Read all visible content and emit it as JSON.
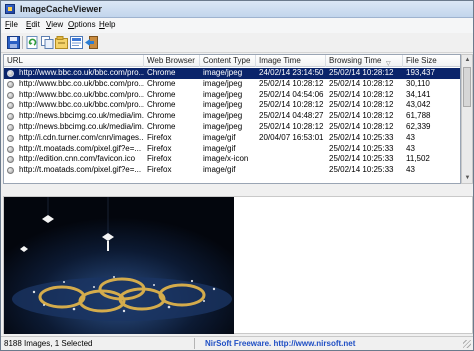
{
  "window": {
    "title": "ImageCacheViewer"
  },
  "menu": [
    {
      "label": "File",
      "hotkey": "F",
      "rest": "ile"
    },
    {
      "label": "Edit",
      "hotkey": "E",
      "rest": "dit"
    },
    {
      "label": "View",
      "hotkey": "V",
      "rest": "iew"
    },
    {
      "label": "Options",
      "hotkey": "O",
      "rest": "ptions"
    },
    {
      "label": "Help",
      "hotkey": "H",
      "rest": "elp"
    }
  ],
  "toolbar": {
    "icons": [
      "save-icon",
      "refresh-icon",
      "copy-icon",
      "properties-icon",
      "html-report-icon",
      "exit-icon"
    ]
  },
  "table": {
    "columns": [
      "URL",
      "Web Browser",
      "Content Type",
      "Image Time",
      "Browsing Time",
      "File Size"
    ],
    "sorted_column": "Browsing Time",
    "rows": [
      {
        "url": "http://www.bbc.co.uk/bbc.com/pro...",
        "browser": "Chrome",
        "type": "image/jpeg",
        "image_time": "24/02/14 23:14:50",
        "browsing_time": "25/02/14 10:28:12",
        "size": "193,437",
        "selected": true
      },
      {
        "url": "http://www.bbc.co.uk/bbc.com/pro...",
        "browser": "Chrome",
        "type": "image/jpeg",
        "image_time": "25/02/14 10:28:12",
        "browsing_time": "25/02/14 10:28:12",
        "size": "30,110",
        "selected": false
      },
      {
        "url": "http://www.bbc.co.uk/bbc.com/pro...",
        "browser": "Chrome",
        "type": "image/jpeg",
        "image_time": "25/02/14 04:54:06",
        "browsing_time": "25/02/14 10:28:12",
        "size": "34,141",
        "selected": false
      },
      {
        "url": "http://www.bbc.co.uk/bbc.com/pro...",
        "browser": "Chrome",
        "type": "image/jpeg",
        "image_time": "25/02/14 10:28:12",
        "browsing_time": "25/02/14 10:28:12",
        "size": "43,042",
        "selected": false
      },
      {
        "url": "http://news.bbcimg.co.uk/media/im...",
        "browser": "Chrome",
        "type": "image/jpeg",
        "image_time": "25/02/14 04:48:27",
        "browsing_time": "25/02/14 10:28:12",
        "size": "61,788",
        "selected": false
      },
      {
        "url": "http://news.bbcimg.co.uk/media/im...",
        "browser": "Chrome",
        "type": "image/jpeg",
        "image_time": "25/02/14 10:28:12",
        "browsing_time": "25/02/14 10:28:12",
        "size": "62,339",
        "selected": false
      },
      {
        "url": "http://i.cdn.turner.com/cnn/images...",
        "browser": "Firefox",
        "type": "image/gif",
        "image_time": "20/04/07 16:53:01",
        "browsing_time": "25/02/14 10:25:33",
        "size": "43",
        "selected": false
      },
      {
        "url": "http://t.moatads.com/pixel.gif?e=...",
        "browser": "Firefox",
        "type": "image/gif",
        "image_time": "",
        "browsing_time": "25/02/14 10:25:33",
        "size": "43",
        "selected": false
      },
      {
        "url": "http://edition.cnn.com/favicon.ico",
        "browser": "Firefox",
        "type": "image/x-icon",
        "image_time": "",
        "browsing_time": "25/02/14 10:25:33",
        "size": "11,502",
        "selected": false
      },
      {
        "url": "http://t.moatads.com/pixel.gif?e=...",
        "browser": "Firefox",
        "type": "image/gif",
        "image_time": "",
        "browsing_time": "25/02/14 10:25:33",
        "size": "43",
        "selected": false
      }
    ]
  },
  "status": {
    "count": "8188 Images, 1 Selected",
    "credit": "NirSoft Freeware.  http://www.nirsoft.net"
  }
}
